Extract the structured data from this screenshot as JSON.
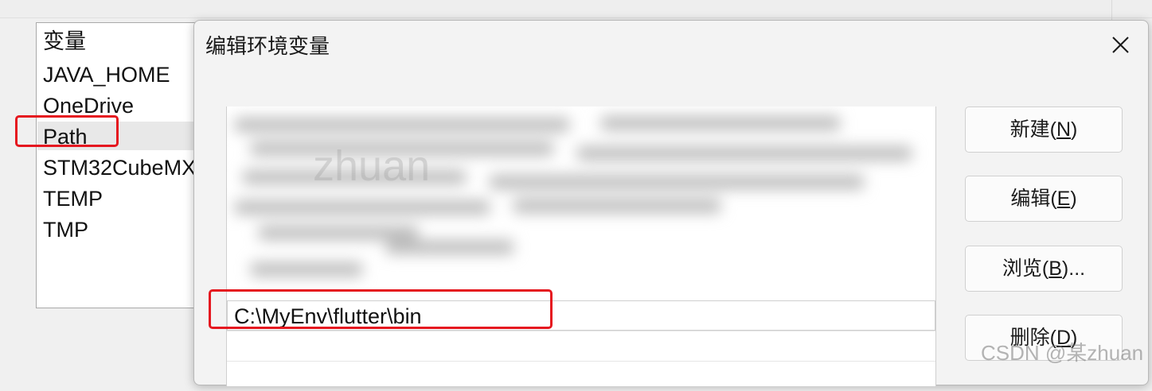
{
  "parent": {
    "variables_header": "变量",
    "variables": [
      "JAVA_HOME",
      "OneDrive",
      "Path",
      "STM32CubeMX",
      "TEMP",
      "TMP"
    ],
    "selected_variable": "Path"
  },
  "dialog": {
    "title": "编辑环境变量",
    "close_label": "✕",
    "path_entries": [
      "C:\\MyEnv\\flutter\\bin"
    ],
    "buttons": {
      "new": {
        "label": "新建(",
        "key": "N",
        "suffix": ")"
      },
      "edit": {
        "label": "编辑(",
        "key": "E",
        "suffix": ")"
      },
      "browse": {
        "label": "浏览(",
        "key": "B",
        "suffix": ")..."
      },
      "delete": {
        "label": "删除(",
        "key": "D",
        "suffix": ")"
      }
    }
  },
  "watermark": {
    "center_text": "zhuan",
    "corner_text": "CSDN @某zhuan"
  },
  "colors": {
    "highlight_red": "#e5171f",
    "dialog_bg": "#f3f3f3"
  },
  "icons": {
    "close": "close-icon"
  }
}
